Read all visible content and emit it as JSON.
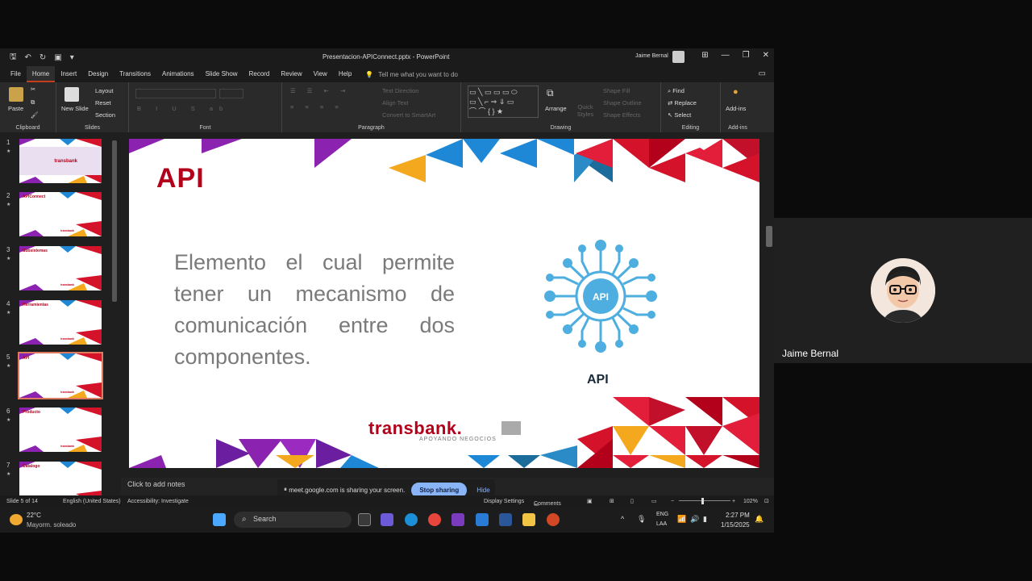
{
  "window": {
    "title": "Presentacion-APIConnect.pptx  -  PowerPoint",
    "user": "Jaime Bernal"
  },
  "menu": {
    "items": [
      "File",
      "Home",
      "Insert",
      "Design",
      "Transitions",
      "Animations",
      "Slide Show",
      "Record",
      "Review",
      "View",
      "Help"
    ],
    "active": "Home",
    "tell_me": "Tell me what you want to do"
  },
  "ribbon": {
    "clipboard": {
      "paste": "Paste",
      "label": "Clipboard"
    },
    "slides": {
      "new_slide": "New Slide",
      "layout": "Layout",
      "reset": "Reset",
      "section": "Section",
      "label": "Slides"
    },
    "font": {
      "label": "Font"
    },
    "paragraph": {
      "text_direction": "Text Direction",
      "align_text": "Align Text",
      "smartart": "Convert to SmartArt",
      "label": "Paragraph"
    },
    "drawing": {
      "arrange": "Arrange",
      "quick_styles": "Quick Styles",
      "shape_fill": "Shape Fill",
      "shape_outline": "Shape Outline",
      "shape_effects": "Shape Effects",
      "label": "Drawing"
    },
    "editing": {
      "find": "Find",
      "replace": "Replace",
      "select": "Select",
      "label": "Editing"
    },
    "addins": {
      "addins": "Add-ins",
      "label": "Add-ins"
    }
  },
  "thumbnails": [
    {
      "num": "1",
      "title": "",
      "brand": "transbank"
    },
    {
      "num": "2",
      "title": "APIConnect",
      "brand": "transbank"
    },
    {
      "num": "3",
      "title": "Subsistemas",
      "brand": "transbank"
    },
    {
      "num": "4",
      "title": "Herramientas",
      "brand": "transbank"
    },
    {
      "num": "5",
      "title": "API",
      "brand": "transbank"
    },
    {
      "num": "6",
      "title": "Producto",
      "brand": "transbank"
    },
    {
      "num": "7",
      "title": "Catalogo",
      "brand": ""
    }
  ],
  "slide": {
    "title": "API",
    "body": "Elemento el cual permite tener un mecanismo de comunicación entre dos componentes.",
    "icon_text": "API",
    "icon_caption": "API",
    "brand": "transbank.",
    "brand_sub": "APOYANDO NEGOCIOS"
  },
  "notes_placeholder": "Click to add notes",
  "share": {
    "text": "meet.google.com is sharing your screen.",
    "stop": "Stop sharing",
    "hide": "Hide"
  },
  "status": {
    "slide": "Slide 5 of 14",
    "language": "English (United States)",
    "accessibility": "Accessibility: Investigate",
    "display": "Display Settings",
    "comments": "Comments",
    "zoom": "102%"
  },
  "taskbar": {
    "temp": "22°C",
    "weather": "Mayorm. soleado",
    "search": "Search",
    "lang1": "ENG",
    "lang2": "LAA",
    "time": "2:27 PM",
    "date": "1/15/2025"
  },
  "participant": {
    "name": "Jaime Bernal"
  },
  "colors": {
    "accent": "#c43e1c",
    "brand_red": "#b3001b",
    "meet_blue": "#8ab4f8"
  }
}
